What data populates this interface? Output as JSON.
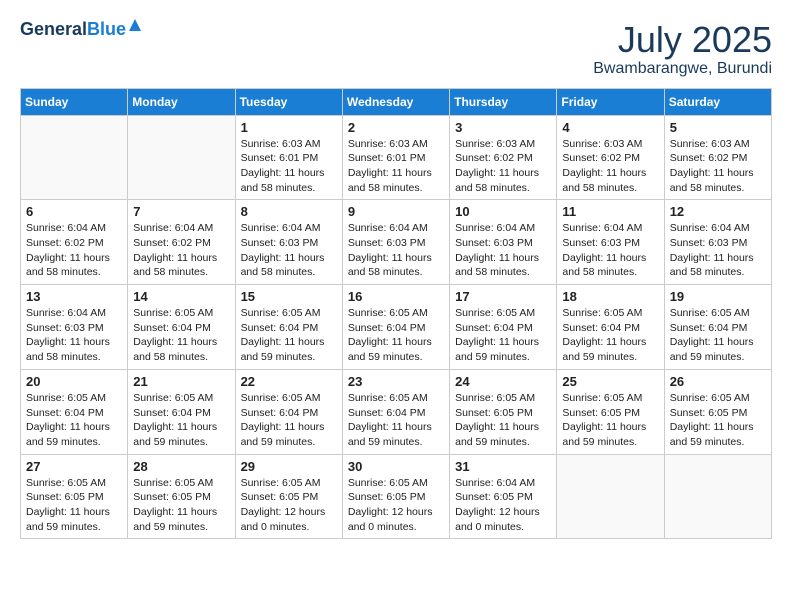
{
  "header": {
    "logo_general": "General",
    "logo_blue": "Blue",
    "month": "July 2025",
    "location": "Bwambarangwe, Burundi"
  },
  "weekdays": [
    "Sunday",
    "Monday",
    "Tuesday",
    "Wednesday",
    "Thursday",
    "Friday",
    "Saturday"
  ],
  "weeks": [
    [
      {
        "day": "",
        "info": ""
      },
      {
        "day": "",
        "info": ""
      },
      {
        "day": "1",
        "info": "Sunrise: 6:03 AM\nSunset: 6:01 PM\nDaylight: 11 hours and 58 minutes."
      },
      {
        "day": "2",
        "info": "Sunrise: 6:03 AM\nSunset: 6:01 PM\nDaylight: 11 hours and 58 minutes."
      },
      {
        "day": "3",
        "info": "Sunrise: 6:03 AM\nSunset: 6:02 PM\nDaylight: 11 hours and 58 minutes."
      },
      {
        "day": "4",
        "info": "Sunrise: 6:03 AM\nSunset: 6:02 PM\nDaylight: 11 hours and 58 minutes."
      },
      {
        "day": "5",
        "info": "Sunrise: 6:03 AM\nSunset: 6:02 PM\nDaylight: 11 hours and 58 minutes."
      }
    ],
    [
      {
        "day": "6",
        "info": "Sunrise: 6:04 AM\nSunset: 6:02 PM\nDaylight: 11 hours and 58 minutes."
      },
      {
        "day": "7",
        "info": "Sunrise: 6:04 AM\nSunset: 6:02 PM\nDaylight: 11 hours and 58 minutes."
      },
      {
        "day": "8",
        "info": "Sunrise: 6:04 AM\nSunset: 6:03 PM\nDaylight: 11 hours and 58 minutes."
      },
      {
        "day": "9",
        "info": "Sunrise: 6:04 AM\nSunset: 6:03 PM\nDaylight: 11 hours and 58 minutes."
      },
      {
        "day": "10",
        "info": "Sunrise: 6:04 AM\nSunset: 6:03 PM\nDaylight: 11 hours and 58 minutes."
      },
      {
        "day": "11",
        "info": "Sunrise: 6:04 AM\nSunset: 6:03 PM\nDaylight: 11 hours and 58 minutes."
      },
      {
        "day": "12",
        "info": "Sunrise: 6:04 AM\nSunset: 6:03 PM\nDaylight: 11 hours and 58 minutes."
      }
    ],
    [
      {
        "day": "13",
        "info": "Sunrise: 6:04 AM\nSunset: 6:03 PM\nDaylight: 11 hours and 58 minutes."
      },
      {
        "day": "14",
        "info": "Sunrise: 6:05 AM\nSunset: 6:04 PM\nDaylight: 11 hours and 58 minutes."
      },
      {
        "day": "15",
        "info": "Sunrise: 6:05 AM\nSunset: 6:04 PM\nDaylight: 11 hours and 59 minutes."
      },
      {
        "day": "16",
        "info": "Sunrise: 6:05 AM\nSunset: 6:04 PM\nDaylight: 11 hours and 59 minutes."
      },
      {
        "day": "17",
        "info": "Sunrise: 6:05 AM\nSunset: 6:04 PM\nDaylight: 11 hours and 59 minutes."
      },
      {
        "day": "18",
        "info": "Sunrise: 6:05 AM\nSunset: 6:04 PM\nDaylight: 11 hours and 59 minutes."
      },
      {
        "day": "19",
        "info": "Sunrise: 6:05 AM\nSunset: 6:04 PM\nDaylight: 11 hours and 59 minutes."
      }
    ],
    [
      {
        "day": "20",
        "info": "Sunrise: 6:05 AM\nSunset: 6:04 PM\nDaylight: 11 hours and 59 minutes."
      },
      {
        "day": "21",
        "info": "Sunrise: 6:05 AM\nSunset: 6:04 PM\nDaylight: 11 hours and 59 minutes."
      },
      {
        "day": "22",
        "info": "Sunrise: 6:05 AM\nSunset: 6:04 PM\nDaylight: 11 hours and 59 minutes."
      },
      {
        "day": "23",
        "info": "Sunrise: 6:05 AM\nSunset: 6:04 PM\nDaylight: 11 hours and 59 minutes."
      },
      {
        "day": "24",
        "info": "Sunrise: 6:05 AM\nSunset: 6:05 PM\nDaylight: 11 hours and 59 minutes."
      },
      {
        "day": "25",
        "info": "Sunrise: 6:05 AM\nSunset: 6:05 PM\nDaylight: 11 hours and 59 minutes."
      },
      {
        "day": "26",
        "info": "Sunrise: 6:05 AM\nSunset: 6:05 PM\nDaylight: 11 hours and 59 minutes."
      }
    ],
    [
      {
        "day": "27",
        "info": "Sunrise: 6:05 AM\nSunset: 6:05 PM\nDaylight: 11 hours and 59 minutes."
      },
      {
        "day": "28",
        "info": "Sunrise: 6:05 AM\nSunset: 6:05 PM\nDaylight: 11 hours and 59 minutes."
      },
      {
        "day": "29",
        "info": "Sunrise: 6:05 AM\nSunset: 6:05 PM\nDaylight: 12 hours and 0 minutes."
      },
      {
        "day": "30",
        "info": "Sunrise: 6:05 AM\nSunset: 6:05 PM\nDaylight: 12 hours and 0 minutes."
      },
      {
        "day": "31",
        "info": "Sunrise: 6:04 AM\nSunset: 6:05 PM\nDaylight: 12 hours and 0 minutes."
      },
      {
        "day": "",
        "info": ""
      },
      {
        "day": "",
        "info": ""
      }
    ]
  ]
}
